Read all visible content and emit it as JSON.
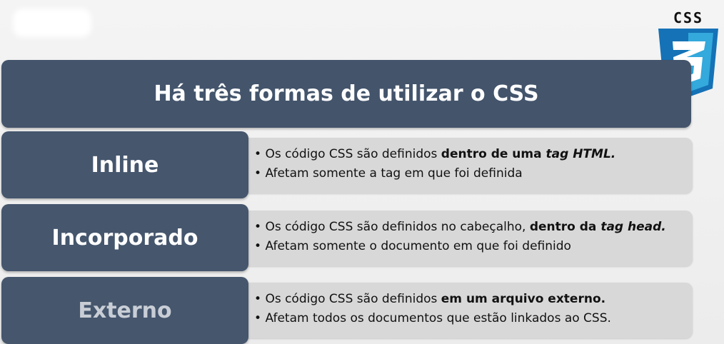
{
  "logo": {
    "text": "CSS",
    "number": "3",
    "shield_color": "#1572b6",
    "shield_light": "#33a9dc"
  },
  "title": "Há três formas de utilizar o CSS",
  "rows": [
    {
      "label": "Inline",
      "line1_pre": "Os código CSS são definidos ",
      "line1_bold": "dentro de uma ",
      "line1_bold_italic": "tag HTML.",
      "line2": "Afetam somente a tag em que foi definida"
    },
    {
      "label": "Incorporado",
      "line1_pre": "Os código CSS são definidos no cabeçalho, ",
      "line1_bold": "dentro da ",
      "line1_bold_italic": "tag head.",
      "line2": "Afetam somente o documento em que foi definido"
    },
    {
      "label": "Externo",
      "line1_pre": "Os código CSS são definidos ",
      "line1_bold": "em um arquivo externo.",
      "line1_bold_italic": "",
      "line2": "Afetam todos os documentos que estão linkados ao CSS."
    }
  ],
  "bullet": "•",
  "colors": {
    "header_bg": "#43546b",
    "desc_bg": "#d8d8d8"
  }
}
